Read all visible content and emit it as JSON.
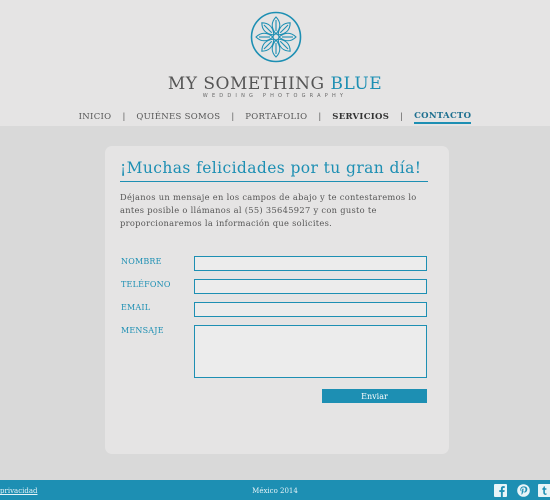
{
  "brand": {
    "name_main": "MY SOMETHING ",
    "name_accent": "BLUE",
    "tagline": "WEDDING PHOTOGRAPHY"
  },
  "nav": {
    "items": [
      {
        "label": "INICIO"
      },
      {
        "label": "QUIÉNES SOMOS"
      },
      {
        "label": "PORTAFOLIO"
      },
      {
        "label": "SERVICIOS"
      },
      {
        "label": "CONTACTO"
      }
    ],
    "separator": "|",
    "active": "CONTACTO"
  },
  "contact": {
    "title": "¡Muchas felicidades por tu gran día!",
    "intro": "Déjanos un mensaje en los campos de abajo y te contestaremos lo antes posible o llámanos al (55) 35645927 y con gusto te proporcionaremos la información que solicites.",
    "fields": {
      "name_label": "NOMBRE",
      "name_value": "",
      "phone_label": "TELÉFONO",
      "phone_value": "",
      "email_label": "EMAIL",
      "email_value": "",
      "message_label": "MENSAJE",
      "message_value": ""
    },
    "submit_label": "Enviar"
  },
  "footer": {
    "privacy_link": "privacidad",
    "copyright": "México 2014",
    "social_icons": [
      "facebook-icon",
      "pinterest-icon",
      "tumblr-icon"
    ]
  },
  "colors": {
    "accent": "#1d8fb3",
    "header_bg": "#e5e4e4",
    "page_bg": "#d9d9d9"
  }
}
